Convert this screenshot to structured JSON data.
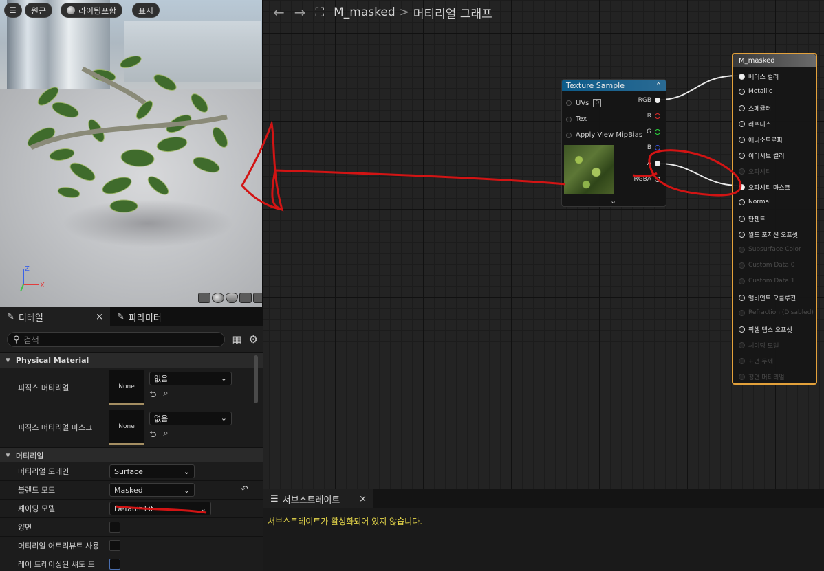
{
  "viewport": {
    "buttons": [
      "원근",
      "라이팅포함",
      "표시"
    ],
    "axis": {
      "z": "Z",
      "x": "X",
      "y": "Y"
    }
  },
  "graph": {
    "breadcrumb_asset": "M_masked",
    "breadcrumb_sep": ">",
    "breadcrumb_page": "머티리얼 그래프",
    "texture_node": {
      "title": "Texture Sample",
      "inputs": [
        "UVs",
        "Tex",
        "Apply View MipBias"
      ],
      "uv_value": "0",
      "outputs": [
        "RGB",
        "R",
        "G",
        "B",
        "A",
        "RGBA"
      ]
    },
    "material_node": {
      "title": "M_masked",
      "pins": [
        {
          "label": "베이스 컬러",
          "enabled": true
        },
        {
          "label": "Metallic",
          "enabled": true
        },
        {
          "label": "스페큘러",
          "enabled": true
        },
        {
          "label": "러프니스",
          "enabled": true
        },
        {
          "label": "애니소트로피",
          "enabled": true
        },
        {
          "label": "이미시브 컬러",
          "enabled": true
        },
        {
          "label": "오파시티",
          "enabled": false
        },
        {
          "label": "오파시티 마스크",
          "enabled": true
        },
        {
          "label": "Normal",
          "enabled": true
        },
        {
          "label": "탄젠트",
          "enabled": true
        },
        {
          "label": "월드 포지션 오프셋",
          "enabled": true
        },
        {
          "label": "Subsurface Color",
          "enabled": false
        },
        {
          "label": "Custom Data 0",
          "enabled": false
        },
        {
          "label": "Custom Data 1",
          "enabled": false
        },
        {
          "label": "앰비언트 오클루전",
          "enabled": true
        },
        {
          "label": "Refraction (Disabled)",
          "enabled": false
        },
        {
          "label": "픽셀 뎁스 오프셋",
          "enabled": true
        },
        {
          "label": "셰이딩 모델",
          "enabled": false
        },
        {
          "label": "표면 두께",
          "enabled": false
        },
        {
          "label": "정면 머티리얼",
          "enabled": false
        }
      ]
    }
  },
  "details": {
    "tab_details": "디테일",
    "tab_params": "파라미터",
    "close_glyph": "×",
    "search_placeholder": "검색",
    "cat_physical": "Physical Material",
    "phys_mat_label": "피직스 머티리얼",
    "phys_mat_thumb": "None",
    "phys_mat_value": "없음",
    "phys_mask_label": "피직스 머티리얼 마스크",
    "phys_mask_thumb": "None",
    "phys_mask_value": "없음",
    "cat_material": "머티리얼",
    "domain_label": "머티리얼 도메인",
    "domain_value": "Surface",
    "blend_label": "블렌드 모드",
    "blend_value": "Masked",
    "shading_label": "셰이딩 모델",
    "shading_value": "Default Lit",
    "twosided_label": "양면",
    "attrs_label": "머티리얼 어트리뷰트 사용",
    "raytraced_label": "레이 트레이싱된 섀도 드"
  },
  "substrate": {
    "tab": "서브스트레이트",
    "close_glyph": "×",
    "message": "서브스트레이트가 활성화되어 있지 않습니다."
  },
  "colors": {
    "annotation": "#d21414",
    "accent_node": "#e3a13b",
    "texture_header": "#0d5b89",
    "warning_text": "#e7d84a"
  }
}
